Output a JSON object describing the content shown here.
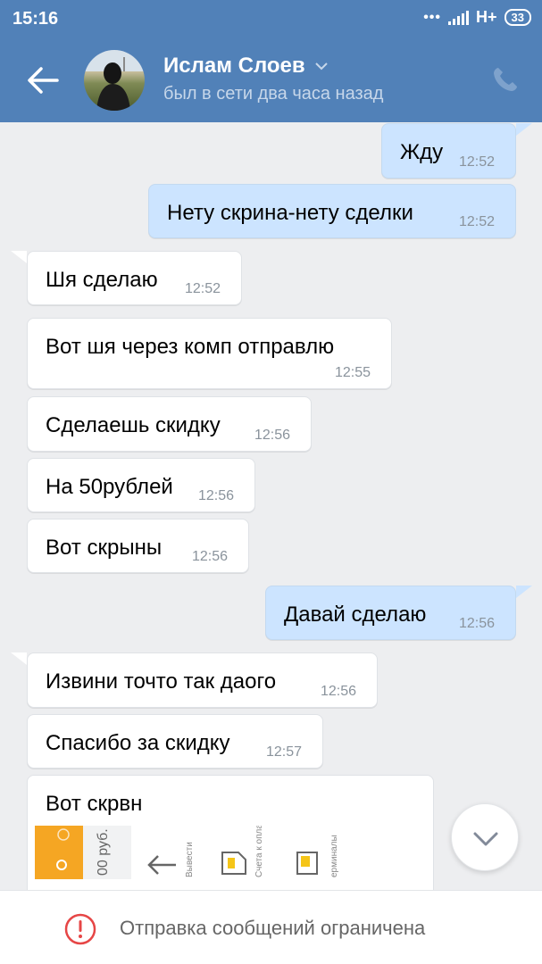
{
  "status_bar": {
    "time": "15:16",
    "network": "H+",
    "battery": "33"
  },
  "header": {
    "name": "Ислам Слоев",
    "status": "был в сети два часа назад"
  },
  "messages": [
    {
      "dir": "out",
      "text": "Жду",
      "time": "12:52"
    },
    {
      "dir": "out",
      "text": "Нету скрина-нету сделки",
      "time": "12:52"
    },
    {
      "dir": "in",
      "text": "Шя сделаю",
      "time": "12:52"
    },
    {
      "dir": "in",
      "text": "Вот шя через комп отправлю",
      "time": "12:55"
    },
    {
      "dir": "in",
      "text": "Сделаешь скидку",
      "time": "12:56"
    },
    {
      "dir": "in",
      "text": "На 50рублей",
      "time": "12:56"
    },
    {
      "dir": "in",
      "text": "Вот скрыны",
      "time": "12:56"
    },
    {
      "dir": "out",
      "text": "Давай сделаю",
      "time": "12:56"
    },
    {
      "dir": "in",
      "text": "Извини точто так даого",
      "time": "12:56"
    },
    {
      "dir": "in",
      "text": "Спасибо за скидку",
      "time": "12:57"
    },
    {
      "dir": "in",
      "text": "Вот скрвн",
      "time": ""
    }
  ],
  "attachment": {
    "amount": "00 руб.",
    "items": [
      "Вывести",
      "Счета к оплате",
      "ерминалы"
    ]
  },
  "bottom": {
    "text": "Отправка сообщений ограничена"
  },
  "colors": {
    "header": "#5181b8",
    "incoming": "#ffffff",
    "outgoing": "#cce4ff",
    "background": "#edeef0",
    "warning": "#e64646"
  }
}
